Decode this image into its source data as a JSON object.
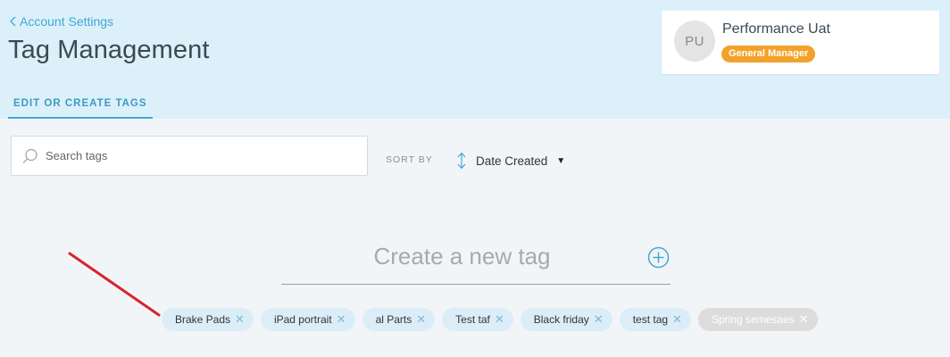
{
  "header": {
    "back_label": "Account Settings",
    "title": "Tag Management",
    "tab_label": "EDIT OR CREATE TAGS"
  },
  "user": {
    "initials": "PU",
    "name": "Performance Uat",
    "role": "General Manager"
  },
  "search": {
    "placeholder": "Search tags"
  },
  "sort": {
    "label": "SORT BY",
    "value": "Date Created"
  },
  "create": {
    "placeholder": "Create a new tag"
  },
  "tags": [
    {
      "label": "Brake Pads",
      "enabled": true
    },
    {
      "label": "iPad portrait",
      "enabled": true
    },
    {
      "label": "al Parts",
      "enabled": true
    },
    {
      "label": "Test taf",
      "enabled": true
    },
    {
      "label": "Black friday",
      "enabled": true
    },
    {
      "label": "test tag",
      "enabled": true
    },
    {
      "label": "Spring semesaes",
      "enabled": false
    }
  ],
  "colors": {
    "accent": "#3fa9d6",
    "header_bg": "#dcf0f9",
    "badge": "#f2a22a",
    "annotation_arrow": "#d9232e"
  }
}
